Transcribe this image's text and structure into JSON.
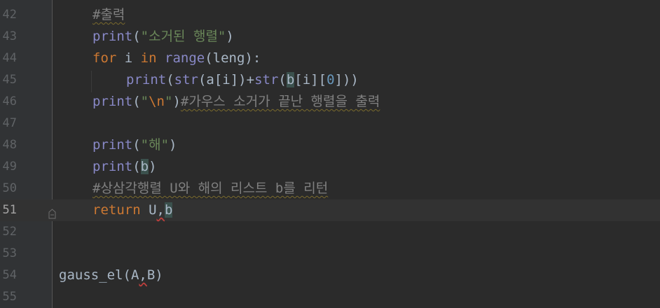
{
  "editor": {
    "lines": [
      {
        "num": "42",
        "tokens": [
          {
            "t": "#출력",
            "k": "cmt"
          }
        ]
      },
      {
        "num": "43",
        "tokens": [
          {
            "t": "print",
            "k": "fn"
          },
          {
            "t": "(",
            "k": "p"
          },
          {
            "t": "\"소거된 행렬\"",
            "k": "str"
          },
          {
            "t": ")",
            "k": "p"
          }
        ]
      },
      {
        "num": "44",
        "tokens": [
          {
            "t": "for",
            "k": "kw"
          },
          {
            "t": " i ",
            "k": "p"
          },
          {
            "t": "in",
            "k": "kw"
          },
          {
            "t": " ",
            "k": "p"
          },
          {
            "t": "range",
            "k": "fn"
          },
          {
            "t": "(leng):",
            "k": "p"
          }
        ]
      },
      {
        "num": "45",
        "tokens": [
          {
            "t": "print",
            "k": "fn"
          },
          {
            "t": "(",
            "k": "p"
          },
          {
            "t": "str",
            "k": "fn"
          },
          {
            "t": "(a[i])+",
            "k": "p"
          },
          {
            "t": "str",
            "k": "fn"
          },
          {
            "t": "(",
            "k": "p"
          },
          {
            "t": "b",
            "k": "match"
          },
          {
            "t": "[i][",
            "k": "p"
          },
          {
            "t": "0",
            "k": "num"
          },
          {
            "t": "]))",
            "k": "p"
          }
        ]
      },
      {
        "num": "46",
        "tokens": [
          {
            "t": "print",
            "k": "fn"
          },
          {
            "t": "(",
            "k": "p"
          },
          {
            "t": "\"",
            "k": "str"
          },
          {
            "t": "\\n",
            "k": "esc"
          },
          {
            "t": "\"",
            "k": "str"
          },
          {
            "t": ")",
            "k": "p"
          },
          {
            "t": "#가우스 소거가 끝난 행렬을 출력",
            "k": "cmt"
          }
        ]
      },
      {
        "num": "47",
        "tokens": []
      },
      {
        "num": "48",
        "tokens": [
          {
            "t": "print",
            "k": "fn"
          },
          {
            "t": "(",
            "k": "p"
          },
          {
            "t": "\"해\"",
            "k": "str"
          },
          {
            "t": ")",
            "k": "p"
          }
        ]
      },
      {
        "num": "49",
        "tokens": [
          {
            "t": "print",
            "k": "fn"
          },
          {
            "t": "(",
            "k": "p"
          },
          {
            "t": "b",
            "k": "match"
          },
          {
            "t": ")",
            "k": "p"
          }
        ]
      },
      {
        "num": "50",
        "tokens": [
          {
            "t": "#상삼각행렬 U와 해의 리스트 b를 리턴",
            "k": "cmt"
          }
        ]
      },
      {
        "num": "51",
        "tokens": [
          {
            "t": "return",
            "k": "kw"
          },
          {
            "t": " U",
            "k": "p"
          },
          {
            "t": ",",
            "k": "warn"
          },
          {
            "t": "b",
            "k": "match"
          }
        ]
      },
      {
        "num": "52",
        "tokens": []
      },
      {
        "num": "53",
        "tokens": []
      },
      {
        "num": "54",
        "tokens": [
          {
            "t": "gauss_el(A",
            "k": "p"
          },
          {
            "t": ",",
            "k": "warn"
          },
          {
            "t": "B)",
            "k": "p"
          }
        ]
      },
      {
        "num": "55",
        "tokens": []
      }
    ],
    "current_line": "51",
    "fold_icon": "fold-marker-icon"
  }
}
